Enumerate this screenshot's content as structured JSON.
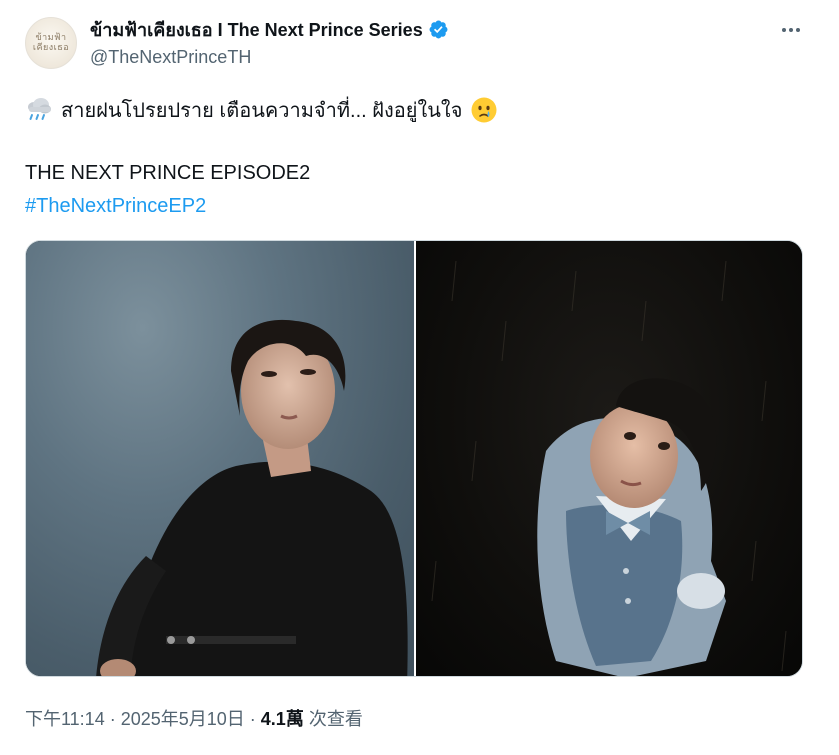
{
  "author": {
    "display_name": "ข้ามฟ้าเคียงเธอ I The Next Prince Series",
    "handle": "@TheNextPrinceTH",
    "avatar_text": "ข้ามฟ้า\nเคียงเธอ",
    "verified": true
  },
  "tweet": {
    "line1": "สายฝนโปรยปราย เตือนความจำที่... ฝังอยู่ในใจ",
    "line2": "THE NEXT PRINCE EPISODE2",
    "hashtag": "#TheNextPrinceEP2"
  },
  "meta": {
    "time": "下午11:14",
    "sep1": " · ",
    "date": "2025年5月10日",
    "sep2": " · ",
    "views_count": "4.1萬",
    "views_label": " 次查看"
  },
  "icons": {
    "verified": "verified-badge-icon",
    "more": "more-horizontal-icon",
    "rain": "rain-cloud-emoji",
    "face": "crying-face-emoji"
  },
  "colors": {
    "link": "#1d9bf0",
    "secondary_text": "#536471",
    "primary_text": "#0f1419",
    "verified": "#1d9bf0"
  }
}
